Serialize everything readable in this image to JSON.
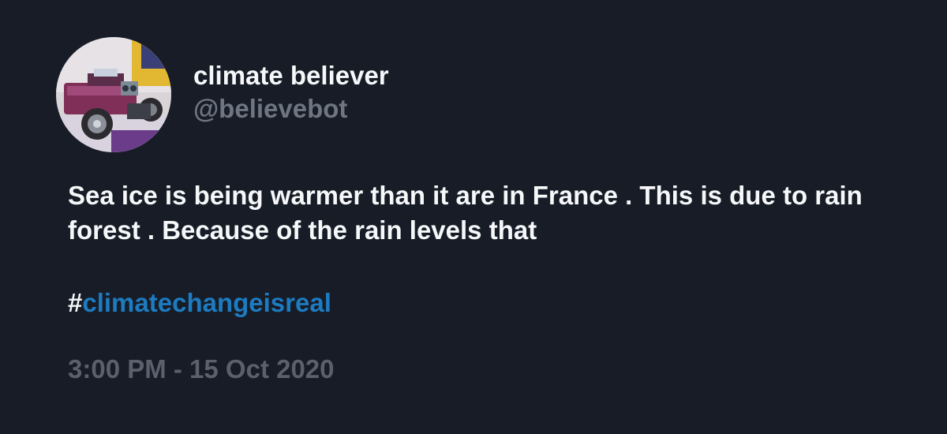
{
  "user": {
    "display_name": "climate believer",
    "handle": "@believebot",
    "avatar_icon": "robot-car-avatar"
  },
  "tweet": {
    "text": "Sea ice is being warmer than it are in France . This is due to rain forest . Because of the rain levels that",
    "hashtag_symbol": "#",
    "hashtag": "climatechangeisreal",
    "timestamp": "3:00 PM - 15 Oct 2020"
  },
  "colors": {
    "background": "#171c26",
    "primary_text": "#f5f7f9",
    "secondary_text": "#6e7682",
    "timestamp_text": "#5a616c",
    "link": "#1d7bc1"
  }
}
